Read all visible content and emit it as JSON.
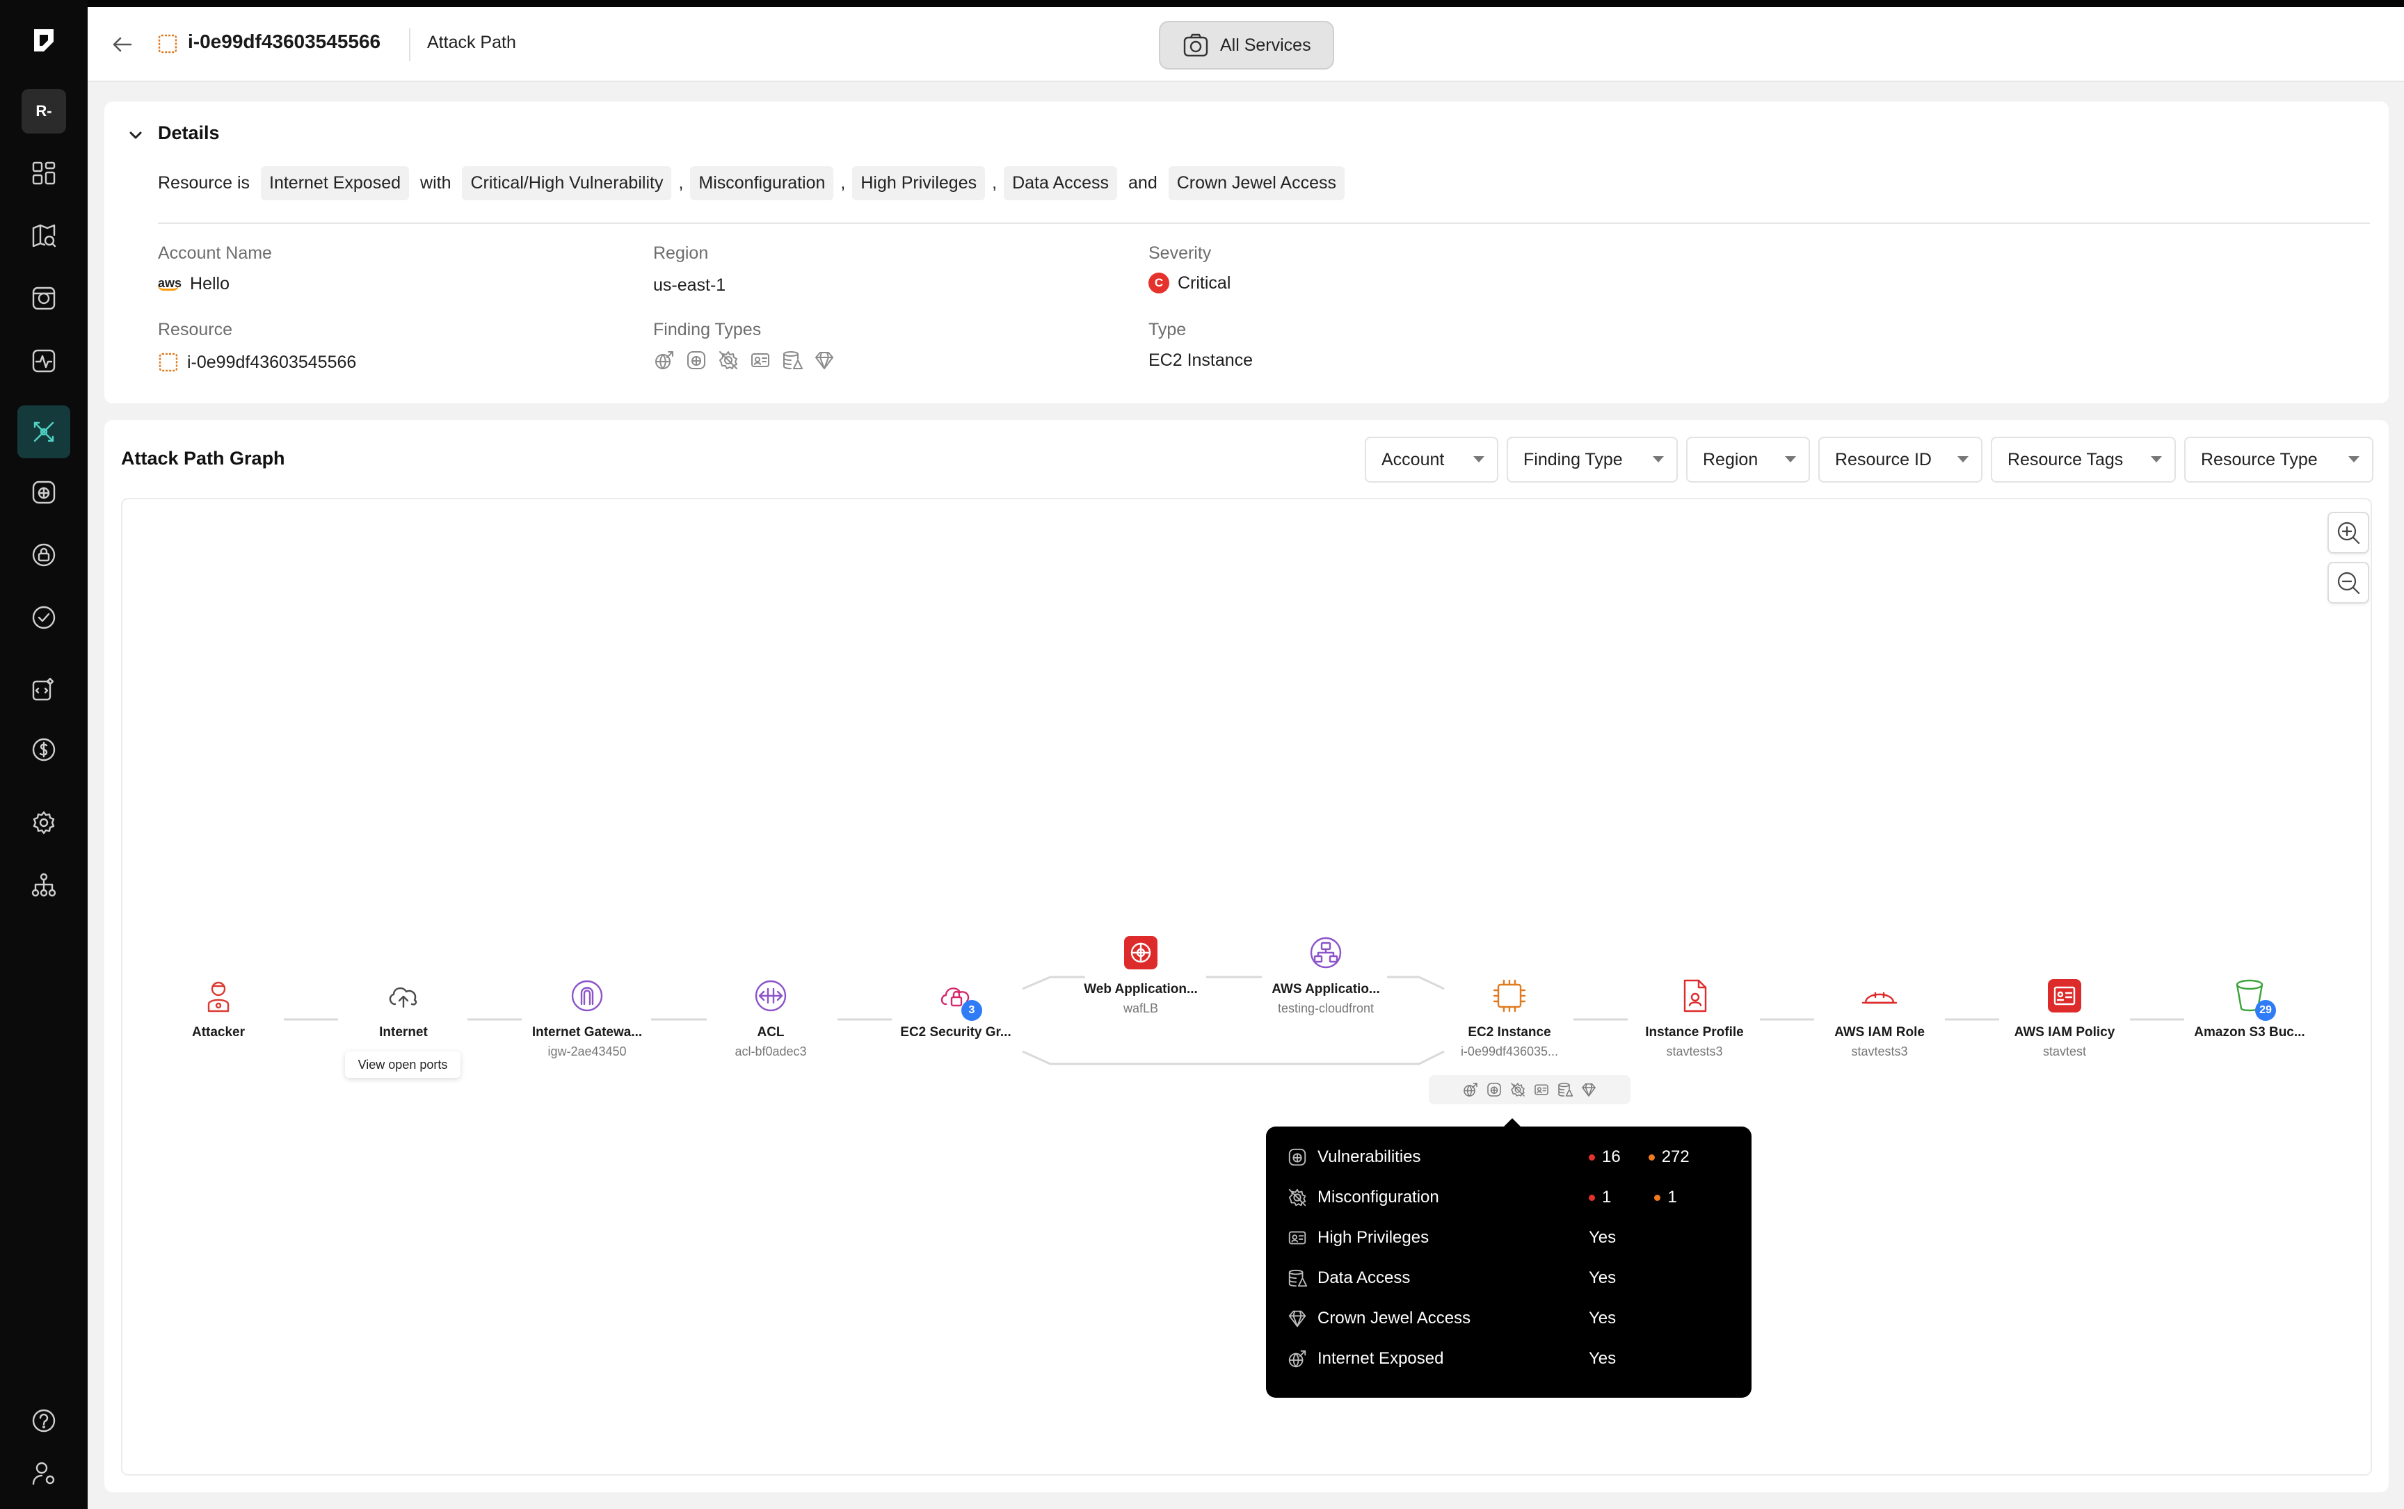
{
  "colors": {
    "sidebar_bg": "#0b0b0b",
    "active_accent": "#4fd3c4",
    "critical": "#e5322d",
    "high": "#f07a1e",
    "badge": "#2f7cf6"
  },
  "sidebar": {
    "org_label": "R-",
    "items": [
      {
        "icon": "dashboard-icon"
      },
      {
        "icon": "map-search-icon"
      },
      {
        "icon": "inventory-icon"
      },
      {
        "icon": "activity-icon"
      },
      {
        "icon": "attack-path-icon",
        "active": true
      },
      {
        "icon": "bug-icon"
      },
      {
        "icon": "lock-icon"
      },
      {
        "icon": "check-circle-icon"
      },
      {
        "icon": "code-scan-icon"
      },
      {
        "icon": "dollar-icon"
      },
      {
        "icon": "settings-icon"
      },
      {
        "icon": "org-tree-icon"
      },
      {
        "icon": "help-icon"
      },
      {
        "icon": "user-settings-icon"
      }
    ]
  },
  "header": {
    "resource_id": "i-0e99df43603545566",
    "breadcrumb": "Attack Path",
    "services_button": "All Services"
  },
  "details": {
    "title": "Details",
    "summary": {
      "prefix": "Resource is",
      "exposure": "Internet Exposed",
      "with": "with",
      "tags": [
        "Critical/High Vulnerability",
        "Misconfiguration",
        "High Privileges",
        "Data Access"
      ],
      "sep": ",",
      "and": "and",
      "last_tag": "Crown Jewel Access"
    },
    "account_name_label": "Account Name",
    "account_name": "Hello",
    "account_provider": "aws",
    "region_label": "Region",
    "region": "us-east-1",
    "severity_label": "Severity",
    "severity_letter": "C",
    "severity": "Critical",
    "resource_label": "Resource",
    "resource": "i-0e99df43603545566",
    "finding_types_label": "Finding Types",
    "finding_type_icons": [
      "internet-exposed-icon",
      "vulnerability-icon",
      "misconfiguration-icon",
      "high-privileges-icon",
      "data-access-icon",
      "crown-jewel-icon"
    ],
    "type_label": "Type",
    "type": "EC2 Instance"
  },
  "graph": {
    "title": "Attack Path Graph",
    "filters": [
      "Account",
      "Finding Type",
      "Region",
      "Resource ID",
      "Resource Tags",
      "Resource Type"
    ],
    "nodes": [
      {
        "label": "Attacker",
        "sub": "",
        "icon": "attacker-icon"
      },
      {
        "label": "Internet",
        "sub": "",
        "icon": "cloud-upload-icon"
      },
      {
        "label": "Internet Gatewa...",
        "sub": "igw-2ae43450",
        "icon": "internet-gateway-icon"
      },
      {
        "label": "ACL",
        "sub": "acl-bf0adec3",
        "icon": "acl-icon"
      },
      {
        "label": "EC2 Security Gr...",
        "sub": "",
        "icon": "security-group-icon",
        "badge": "3"
      },
      {
        "label": "Web Application...",
        "sub": "wafLB",
        "icon": "waf-icon"
      },
      {
        "label": "AWS Applicatio...",
        "sub": "testing-cloudfront",
        "icon": "app-lb-icon"
      },
      {
        "label": "EC2 Instance",
        "sub": "i-0e99df436035...",
        "icon": "ec2-chip-icon"
      },
      {
        "label": "Instance Profile",
        "sub": "stavtests3",
        "icon": "instance-profile-icon"
      },
      {
        "label": "AWS IAM Role",
        "sub": "stavtests3",
        "icon": "iam-role-icon"
      },
      {
        "label": "AWS IAM Policy",
        "sub": "stavtest",
        "icon": "iam-policy-icon"
      },
      {
        "label": "Amazon S3 Buc...",
        "sub": "",
        "icon": "s3-bucket-icon",
        "badge": "29"
      }
    ],
    "view_open_ports": "View open ports",
    "tooltip": {
      "rows": [
        {
          "icon": "vulnerability-icon",
          "name": "Vulnerabilities",
          "critical": "16",
          "high": "272"
        },
        {
          "icon": "misconfiguration-icon",
          "name": "Misconfiguration",
          "critical": "1",
          "high": "1"
        },
        {
          "icon": "high-privileges-icon",
          "name": "High Privileges",
          "value": "Yes"
        },
        {
          "icon": "data-access-icon",
          "name": "Data Access",
          "value": "Yes"
        },
        {
          "icon": "crown-jewel-icon",
          "name": "Crown Jewel Access",
          "value": "Yes"
        },
        {
          "icon": "internet-exposed-icon",
          "name": "Internet Exposed",
          "value": "Yes"
        }
      ]
    }
  }
}
